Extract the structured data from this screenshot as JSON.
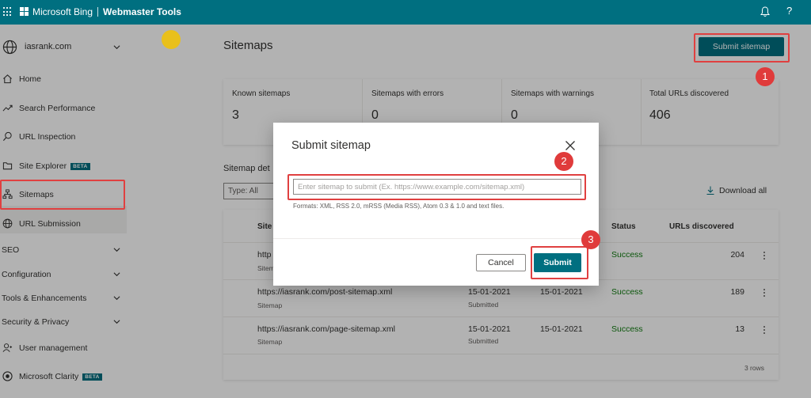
{
  "topbar": {
    "brand": "Microsoft Bing",
    "tool": "Webmaster Tools",
    "help_label": "?"
  },
  "sidebar": {
    "site": "iasrank.com",
    "items": [
      {
        "label": "Home",
        "icon": "home-icon"
      },
      {
        "label": "Search Performance",
        "icon": "trend-icon"
      },
      {
        "label": "URL Inspection",
        "icon": "search-icon"
      },
      {
        "label": "Site Explorer",
        "icon": "folder-icon",
        "badge": "BETA"
      },
      {
        "label": "Sitemaps",
        "icon": "sitemap-icon"
      },
      {
        "label": "URL Submission",
        "icon": "globe-icon"
      }
    ],
    "groups": [
      {
        "label": "SEO"
      },
      {
        "label": "Configuration"
      },
      {
        "label": "Tools & Enhancements"
      },
      {
        "label": "Security & Privacy"
      }
    ],
    "bottom": [
      {
        "label": "User management",
        "icon": "user-icon"
      },
      {
        "label": "Microsoft Clarity",
        "icon": "clarity-icon",
        "badge": "BETA"
      }
    ]
  },
  "main": {
    "title": "Sitemaps",
    "submit_button": "Submit sitemap",
    "stats": [
      {
        "label": "Known sitemaps",
        "value": "3"
      },
      {
        "label": "Sitemaps with errors",
        "value": "0"
      },
      {
        "label": "Sitemaps with warnings",
        "value": "0"
      },
      {
        "label": "Total URLs discovered",
        "value": "406"
      }
    ],
    "details_label": "Sitemap det",
    "type_filter": "Type: All",
    "download_all": "Download all",
    "table": {
      "headers": {
        "sitemap": "Site",
        "status": "Status",
        "urls": "URLs discovered"
      },
      "rows": [
        {
          "url": "http",
          "type": "Sitem",
          "submitted": "",
          "submitted_label": "",
          "last_read": "",
          "status": "Success",
          "urls": "204"
        },
        {
          "url": "https://iasrank.com/post-sitemap.xml",
          "type": "Sitemap",
          "submitted": "15-01-2021",
          "submitted_label": "Submitted",
          "last_read": "15-01-2021",
          "status": "Success",
          "urls": "189"
        },
        {
          "url": "https://iasrank.com/page-sitemap.xml",
          "type": "Sitemap",
          "submitted": "15-01-2021",
          "submitted_label": "Submitted",
          "last_read": "15-01-2021",
          "status": "Success",
          "urls": "13"
        }
      ],
      "rows_count": "3 rows"
    }
  },
  "modal": {
    "title": "Submit sitemap",
    "input_placeholder": "Enter sitemap to submit (Ex. https://www.example.com/sitemap.xml)",
    "formats": "Formats: XML, RSS 2.0, mRSS (Media RSS), Atom 0.3 & 1.0 and text files.",
    "cancel": "Cancel",
    "submit": "Submit"
  },
  "annotations": {
    "step1": "1",
    "step2": "2",
    "step3": "3"
  },
  "colors": {
    "brand": "#006f80",
    "highlight": "#e04040",
    "success": "#107c10"
  }
}
